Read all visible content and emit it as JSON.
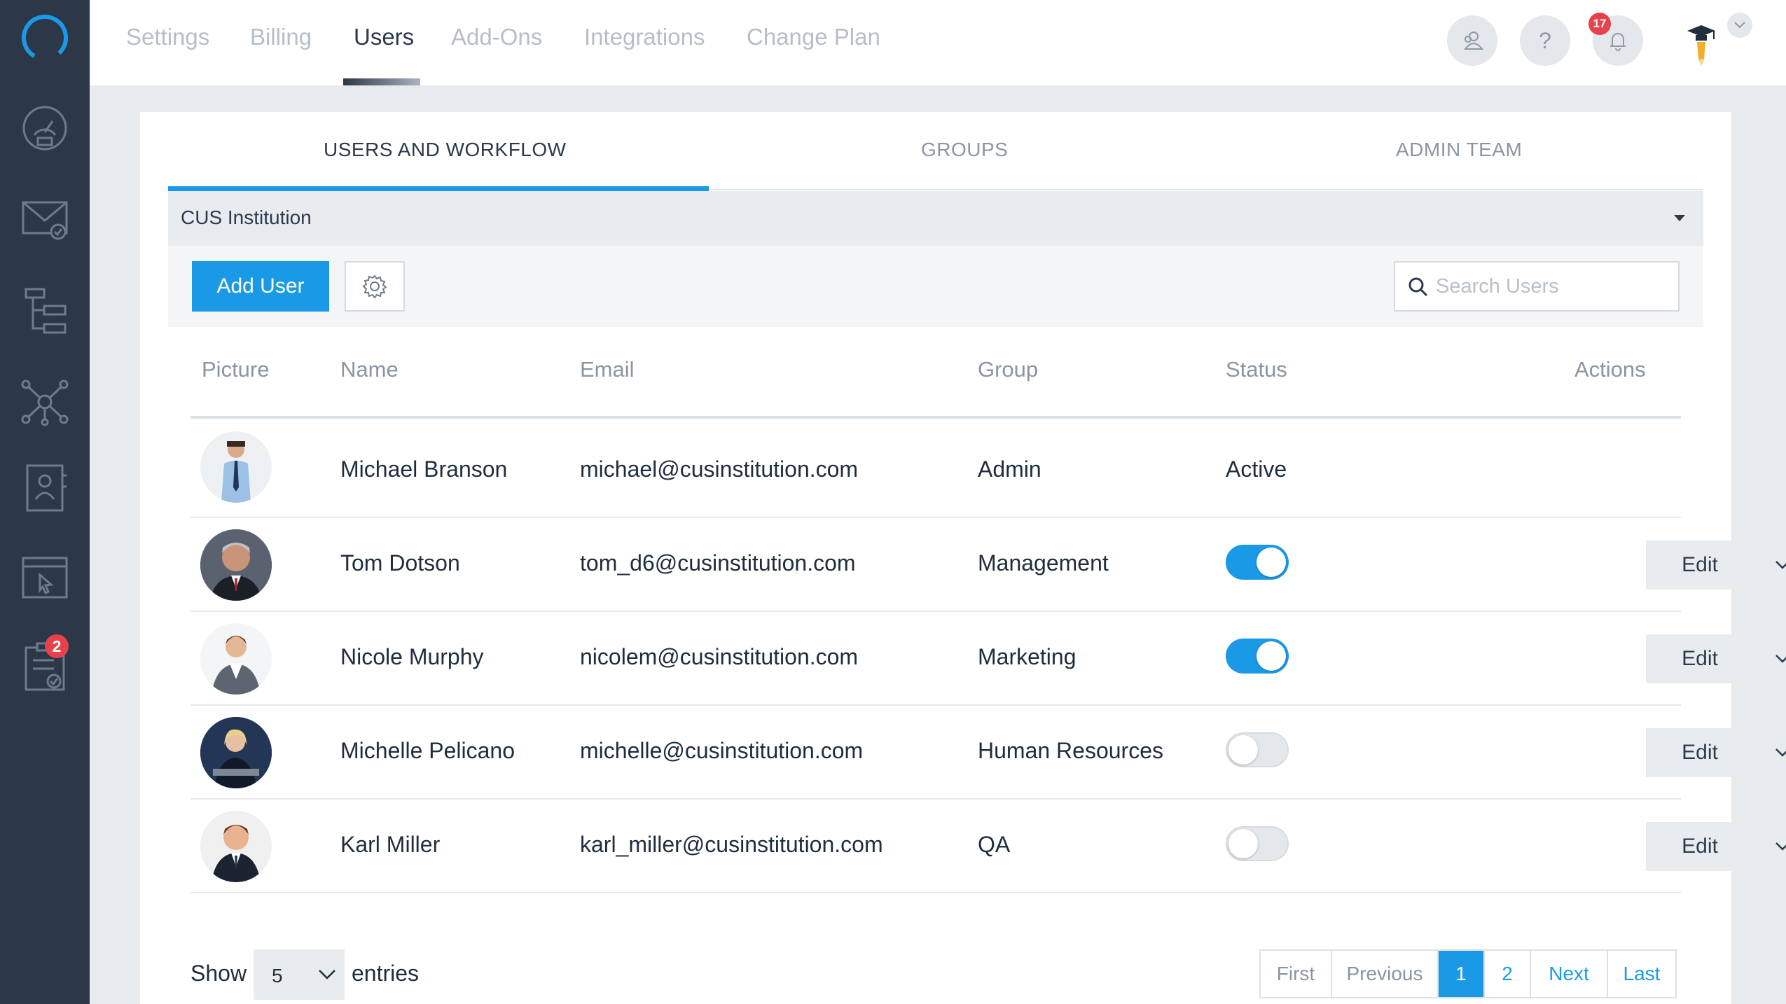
{
  "topnav": {
    "items": [
      {
        "label": "Settings"
      },
      {
        "label": "Billing"
      },
      {
        "label": "Users"
      },
      {
        "label": "Add-Ons"
      },
      {
        "label": "Integrations"
      },
      {
        "label": "Change Plan"
      }
    ],
    "active": "Users",
    "help_label": "?",
    "notifications_count": "17"
  },
  "sidebar": {
    "items": [
      {
        "icon": "dashboard-icon"
      },
      {
        "icon": "mail-icon"
      },
      {
        "icon": "hierarchy-icon"
      },
      {
        "icon": "network-icon"
      },
      {
        "icon": "contact-card-icon"
      },
      {
        "icon": "browser-cursor-icon"
      },
      {
        "icon": "checklist-icon",
        "badge": "2"
      }
    ]
  },
  "tabs": [
    {
      "label": "USERS AND WORKFLOW"
    },
    {
      "label": "GROUPS"
    },
    {
      "label": "ADMIN TEAM"
    }
  ],
  "institution": {
    "label": "CUS Institution"
  },
  "toolbar": {
    "add_user_label": "Add User",
    "search_placeholder": "Search Users"
  },
  "table": {
    "headers": {
      "picture": "Picture",
      "name": "Name",
      "email": "Email",
      "group": "Group",
      "status": "Status",
      "actions": "Actions"
    },
    "rows": [
      {
        "name": "Michael Branson",
        "email": "michael@cusinstitution.com",
        "group": "Admin",
        "status_text": "Active"
      },
      {
        "name": "Tom Dotson",
        "email": "tom_d6@cusinstitution.com",
        "group": "Management",
        "enabled": true,
        "edit_label": "Edit"
      },
      {
        "name": "Nicole Murphy",
        "email": "nicolem@cusinstitution.com",
        "group": "Marketing",
        "enabled": true,
        "edit_label": "Edit"
      },
      {
        "name": "Michelle Pelicano",
        "email": "michelle@cusinstitution.com",
        "group": "Human Resources",
        "enabled": false,
        "edit_label": "Edit"
      },
      {
        "name": "Karl Miller",
        "email": "karl_miller@cusinstitution.com",
        "group": "QA",
        "enabled": false,
        "edit_label": "Edit"
      }
    ]
  },
  "footer": {
    "show_label": "Show",
    "entries_value": "5",
    "entries_label": "entries",
    "pagination": {
      "first": "First",
      "previous": "Previous",
      "pages": [
        "1",
        "2"
      ],
      "current": "1",
      "next": "Next",
      "last": "Last"
    }
  },
  "colors": {
    "accent": "#1a9ae6",
    "sidebar": "#2c3848",
    "badge": "#e8414c"
  }
}
